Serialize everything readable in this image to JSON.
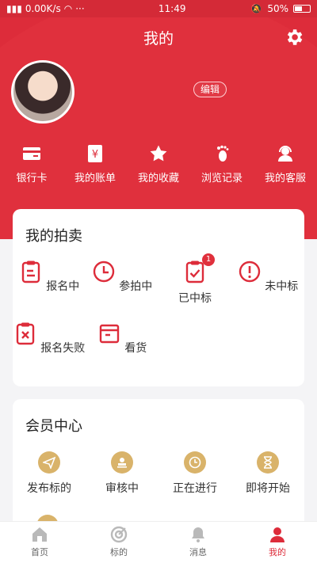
{
  "status_bar": {
    "network": "0.00K/s",
    "time": "11:49",
    "battery": "50%"
  },
  "header": {
    "title": "我的",
    "edit_label": "编辑"
  },
  "quick_actions": [
    {
      "label": "银行卡",
      "icon": "bank-card-icon"
    },
    {
      "label": "我的账单",
      "icon": "bill-icon"
    },
    {
      "label": "我的收藏",
      "icon": "star-icon"
    },
    {
      "label": "浏览记录",
      "icon": "footprint-icon"
    },
    {
      "label": "我的客服",
      "icon": "customer-service-icon"
    }
  ],
  "auction": {
    "title": "我的拍卖",
    "items": [
      {
        "label": "报名中",
        "icon": "clipboard-icon"
      },
      {
        "label": "参拍中",
        "icon": "clock-icon"
      },
      {
        "label": "已中标",
        "icon": "clipboard-check-icon",
        "badge": "1"
      },
      {
        "label": "未中标",
        "icon": "exclamation-icon"
      },
      {
        "label": "报名失败",
        "icon": "clipboard-x-icon"
      },
      {
        "label": "看货",
        "icon": "box-icon"
      }
    ]
  },
  "member": {
    "title": "会员中心",
    "items": [
      {
        "label": "发布标的",
        "icon": "send-icon"
      },
      {
        "label": "审核中",
        "icon": "stamp-icon"
      },
      {
        "label": "正在进行",
        "icon": "clock-icon"
      },
      {
        "label": "即将开始",
        "icon": "hourglass-icon"
      }
    ]
  },
  "tabbar": [
    {
      "label": "首页",
      "icon": "home-icon"
    },
    {
      "label": "标的",
      "icon": "target-icon"
    },
    {
      "label": "消息",
      "icon": "bell-icon"
    },
    {
      "label": "我的",
      "icon": "user-icon",
      "active": true
    }
  ],
  "colors": {
    "primary": "#dd2c3a",
    "gold": "#d9b36a"
  }
}
